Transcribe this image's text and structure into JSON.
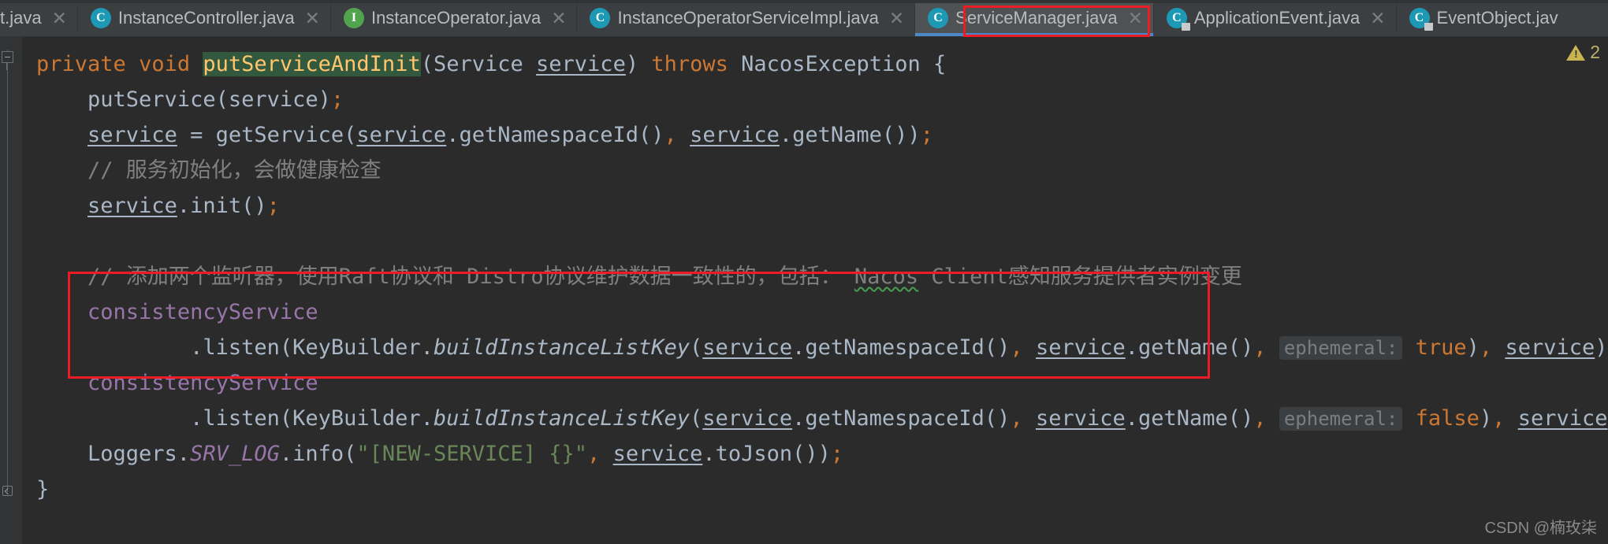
{
  "window": {
    "theme": "darcula",
    "accent_blue": "#4a88c7",
    "annotation_color": "#ed1c24",
    "editor_background": "#2b2b2b",
    "tabbar_background": "#3c3f41"
  },
  "tabbar": {
    "tabs": [
      {
        "label": "t.java",
        "icon": "java-class-icon",
        "icon_letter": "C",
        "icon_kind": "cls",
        "active": false,
        "truncated_left": true,
        "closable": true
      },
      {
        "label": "InstanceController.java",
        "icon": "java-class-icon",
        "icon_letter": "C",
        "icon_kind": "cls",
        "active": false,
        "truncated_left": false,
        "closable": true
      },
      {
        "label": "InstanceOperator.java",
        "icon": "java-interface-icon",
        "icon_letter": "I",
        "icon_kind": "iface",
        "active": false,
        "truncated_left": false,
        "closable": true
      },
      {
        "label": "InstanceOperatorServiceImpl.java",
        "icon": "java-class-icon",
        "icon_letter": "C",
        "icon_kind": "cls",
        "active": false,
        "truncated_left": false,
        "closable": true
      },
      {
        "label": "ServiceManager.java",
        "icon": "java-class-icon",
        "icon_letter": "C",
        "icon_kind": "cls",
        "active": true,
        "truncated_left": false,
        "closable": true
      },
      {
        "label": "ApplicationEvent.java",
        "icon": "java-class-readonly-icon",
        "icon_letter": "C",
        "icon_kind": "cls locked",
        "active": false,
        "truncated_left": false,
        "closable": true
      },
      {
        "label": "EventObject.jav",
        "icon": "java-class-readonly-icon",
        "icon_letter": "C",
        "icon_kind": "cls locked",
        "active": false,
        "truncated_left": false,
        "closable": false
      }
    ],
    "close_glyph": "✕"
  },
  "inspection": {
    "warning_count": "2",
    "icon": "warning-triangle-icon"
  },
  "watermark": {
    "text": "CSDN @楠玫柒"
  },
  "code": {
    "language": "java",
    "file": "ServiceManager.java",
    "lines": [
      {
        "id": "line-signature",
        "tokens": [
          {
            "t": "private",
            "c": "kw"
          },
          {
            "t": " ",
            "c": "plain"
          },
          {
            "t": "void",
            "c": "kw"
          },
          {
            "t": " ",
            "c": "plain"
          },
          {
            "t": "putServiceAndInit",
            "c": "mdecl"
          },
          {
            "t": "(",
            "c": "plain"
          },
          {
            "t": "Service",
            "c": "type"
          },
          {
            "t": " ",
            "c": "plain"
          },
          {
            "t": "service",
            "c": "param"
          },
          {
            "t": ")",
            "c": "plain"
          },
          {
            "t": " ",
            "c": "plain"
          },
          {
            "t": "throws",
            "c": "kw"
          },
          {
            "t": " NacosException {",
            "c": "plain"
          }
        ]
      },
      {
        "id": "line-putservice",
        "tokens": [
          {
            "t": "    putService(service)",
            "c": "plain"
          },
          {
            "t": ";",
            "c": "punct"
          }
        ]
      },
      {
        "id": "line-getservice",
        "tokens": [
          {
            "t": "    ",
            "c": "plain"
          },
          {
            "t": "service",
            "c": "param"
          },
          {
            "t": " = getService(",
            "c": "plain"
          },
          {
            "t": "service",
            "c": "param"
          },
          {
            "t": ".getNamespaceId()",
            "c": "plain"
          },
          {
            "t": ",",
            "c": "punct"
          },
          {
            "t": " ",
            "c": "plain"
          },
          {
            "t": "service",
            "c": "param"
          },
          {
            "t": ".getName())",
            "c": "plain"
          },
          {
            "t": ";",
            "c": "punct"
          }
        ]
      },
      {
        "id": "line-comment-init",
        "tokens": [
          {
            "t": "    // 服务初始化，会做健康检查",
            "c": "cmt"
          }
        ]
      },
      {
        "id": "line-init-call",
        "tokens": [
          {
            "t": "    ",
            "c": "plain"
          },
          {
            "t": "service",
            "c": "param"
          },
          {
            "t": ".init()",
            "c": "plain"
          },
          {
            "t": ";",
            "c": "punct"
          }
        ]
      },
      {
        "id": "line-blank-1",
        "tokens": [
          {
            "t": " ",
            "c": "plain"
          }
        ]
      },
      {
        "id": "line-comment-listeners",
        "tokens": [
          {
            "t": "    // 添加两个监听器，使用Raft协议和 Distro协议维护数据一致性的，包括： ",
            "c": "cmt"
          },
          {
            "t": "Nacos",
            "c": "cmt typo"
          },
          {
            "t": " Client感知服务提供者实例变更",
            "c": "cmt"
          }
        ]
      },
      {
        "id": "line-consistency-1",
        "tokens": [
          {
            "t": "    ",
            "c": "plain"
          },
          {
            "t": "consistencyService",
            "c": "field"
          }
        ]
      },
      {
        "id": "line-listen-ephemeral-true",
        "tokens": [
          {
            "t": "            .listen(KeyBuilder.",
            "c": "plain"
          },
          {
            "t": "buildInstanceListKey",
            "c": "staticm"
          },
          {
            "t": "(",
            "c": "plain"
          },
          {
            "t": "service",
            "c": "param"
          },
          {
            "t": ".getNamespaceId()",
            "c": "plain"
          },
          {
            "t": ",",
            "c": "punct"
          },
          {
            "t": " ",
            "c": "plain"
          },
          {
            "t": "service",
            "c": "param"
          },
          {
            "t": ".getName()",
            "c": "plain"
          },
          {
            "t": ",",
            "c": "punct"
          },
          {
            "t": " ",
            "c": "plain"
          },
          {
            "t": "ephemeral:",
            "c": "hint"
          },
          {
            "t": " ",
            "c": "plain"
          },
          {
            "t": "true",
            "c": "bool"
          },
          {
            "t": ")",
            "c": "plain"
          },
          {
            "t": ",",
            "c": "punct"
          },
          {
            "t": " ",
            "c": "plain"
          },
          {
            "t": "service",
            "c": "param"
          },
          {
            "t": ")",
            "c": "plain"
          },
          {
            "t": ";",
            "c": "punct"
          }
        ]
      },
      {
        "id": "line-consistency-2",
        "tokens": [
          {
            "t": "    ",
            "c": "plain"
          },
          {
            "t": "consistencyService",
            "c": "field"
          }
        ]
      },
      {
        "id": "line-listen-ephemeral-false",
        "tokens": [
          {
            "t": "            .listen(KeyBuilder.",
            "c": "plain"
          },
          {
            "t": "buildInstanceListKey",
            "c": "staticm"
          },
          {
            "t": "(",
            "c": "plain"
          },
          {
            "t": "service",
            "c": "param"
          },
          {
            "t": ".getNamespaceId()",
            "c": "plain"
          },
          {
            "t": ",",
            "c": "punct"
          },
          {
            "t": " ",
            "c": "plain"
          },
          {
            "t": "service",
            "c": "param"
          },
          {
            "t": ".getName()",
            "c": "plain"
          },
          {
            "t": ",",
            "c": "punct"
          },
          {
            "t": " ",
            "c": "plain"
          },
          {
            "t": "ephemeral:",
            "c": "hint"
          },
          {
            "t": " ",
            "c": "plain"
          },
          {
            "t": "false",
            "c": "bool"
          },
          {
            "t": ")",
            "c": "plain"
          },
          {
            "t": ",",
            "c": "punct"
          },
          {
            "t": " ",
            "c": "plain"
          },
          {
            "t": "service",
            "c": "param"
          },
          {
            "t": ")",
            "c": "plain"
          },
          {
            "t": ";",
            "c": "punct"
          }
        ]
      },
      {
        "id": "line-logger",
        "tokens": [
          {
            "t": "    Loggers.",
            "c": "plain"
          },
          {
            "t": "SRV_LOG",
            "c": "constf"
          },
          {
            "t": ".info(",
            "c": "plain"
          },
          {
            "t": "\"[NEW-SERVICE] {}\"",
            "c": "str"
          },
          {
            "t": ",",
            "c": "punct"
          },
          {
            "t": " ",
            "c": "plain"
          },
          {
            "t": "service",
            "c": "param"
          },
          {
            "t": ".toJson())",
            "c": "plain"
          },
          {
            "t": ";",
            "c": "punct"
          }
        ]
      },
      {
        "id": "line-close-brace",
        "tokens": [
          {
            "t": "}",
            "c": "plain"
          }
        ]
      }
    ]
  }
}
